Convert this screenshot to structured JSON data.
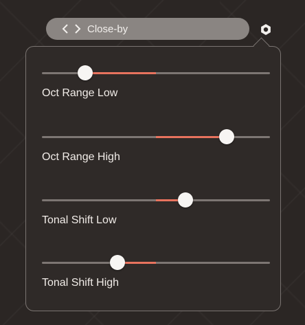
{
  "header": {
    "preset_name": "Close-by"
  },
  "icons": {
    "prev": "chevron-left-icon",
    "next": "chevron-right-icon",
    "settings": "gear-icon"
  },
  "colors": {
    "accent": "#e8735e",
    "track": "#7d7673",
    "thumb": "#f7f5f3",
    "panel_bg": "#2f2a28"
  },
  "sliders": [
    {
      "label": "Oct Range Low",
      "value": 0.19,
      "origin": 0.5
    },
    {
      "label": "Oct Range High",
      "value": 0.81,
      "origin": 0.5
    },
    {
      "label": "Tonal Shift Low",
      "value": 0.63,
      "origin": 0.5
    },
    {
      "label": "Tonal Shift High",
      "value": 0.33,
      "origin": 0.5
    }
  ]
}
